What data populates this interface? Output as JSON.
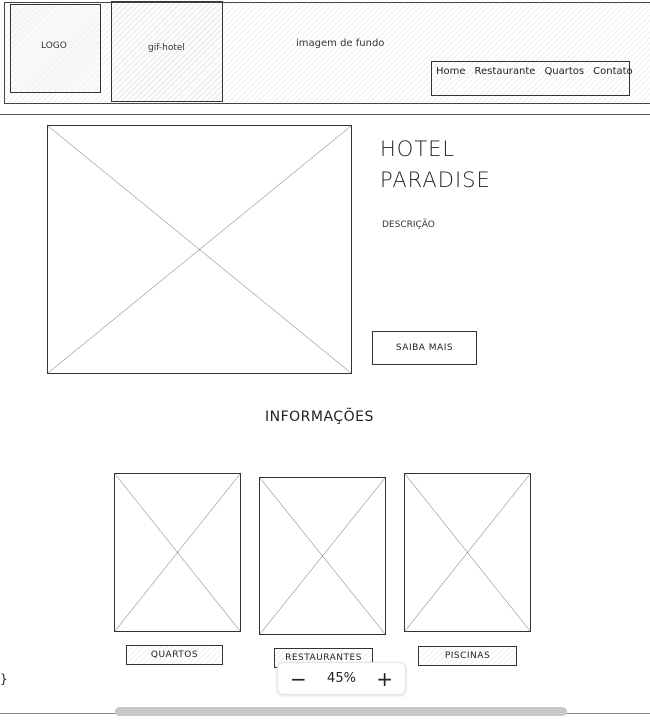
{
  "header": {
    "logo_label": "LOGO",
    "gif_label": "gif-hotel",
    "background_label": "imagem de fundo",
    "nav": [
      "Home",
      "Restaurante",
      "Quartos",
      "Contato"
    ]
  },
  "hero": {
    "title_line1": "HOTEL",
    "title_line2": "PARADISE",
    "description": "DESCRIÇÃO",
    "button_label": "SAIBA MAIS"
  },
  "info": {
    "title": "INFORMAÇÕES",
    "cards": [
      {
        "label": "QUARTOS"
      },
      {
        "label": "RESTAURANTES"
      },
      {
        "label": "PISCINAS"
      }
    ]
  },
  "zoom": {
    "minus": "−",
    "level": "45%",
    "plus": "+"
  },
  "edge_glyph": "}"
}
